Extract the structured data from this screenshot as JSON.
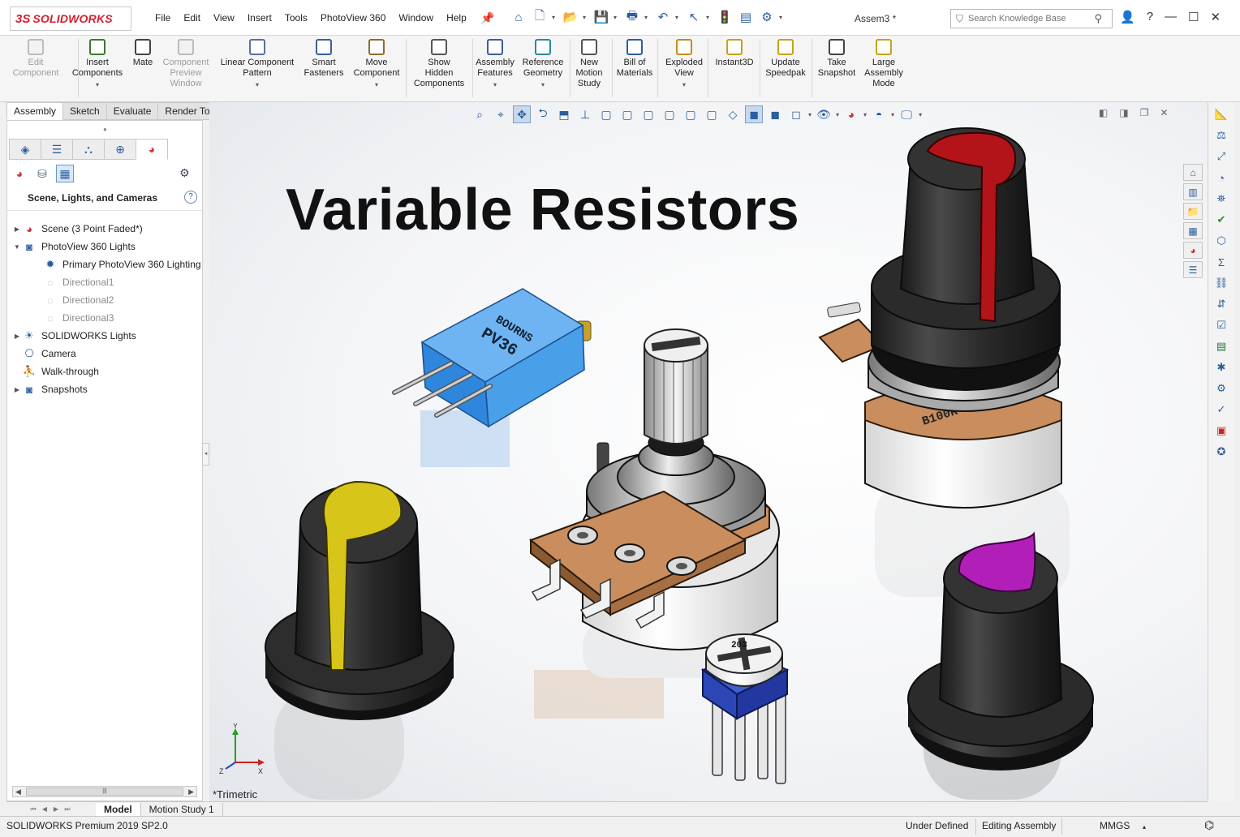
{
  "app": {
    "logo_mark": "3S",
    "logo_text": "SOLIDWORKS",
    "document_title": "Assem3 *",
    "menu": [
      "File",
      "Edit",
      "View",
      "Insert",
      "Tools",
      "PhotoView 360",
      "Window",
      "Help"
    ],
    "search_placeholder": "Search Knowledge Base",
    "window_controls": [
      "person-icon",
      "help-icon",
      "minimize-icon",
      "maximize-icon",
      "close-icon"
    ]
  },
  "command_manager": {
    "commands": [
      {
        "label1": "Edit",
        "label2": "Component",
        "label3": "",
        "enabled": false,
        "dropdown": false,
        "icon": "edit-component-icon"
      },
      {
        "label1": "Insert",
        "label2": "Components",
        "label3": "",
        "enabled": true,
        "dropdown": true,
        "icon": "insert-components-icon"
      },
      {
        "label1": "Mate",
        "label2": "",
        "label3": "",
        "enabled": true,
        "dropdown": false,
        "icon": "mate-icon"
      },
      {
        "label1": "Component",
        "label2": "Preview",
        "label3": "Window",
        "enabled": false,
        "dropdown": false,
        "icon": "component-preview-icon"
      },
      {
        "label1": "Linear Component",
        "label2": "Pattern",
        "label3": "",
        "enabled": true,
        "dropdown": true,
        "icon": "linear-pattern-icon"
      },
      {
        "label1": "Smart",
        "label2": "Fasteners",
        "label3": "",
        "enabled": true,
        "dropdown": false,
        "icon": "smart-fasteners-icon"
      },
      {
        "label1": "Move",
        "label2": "Component",
        "label3": "",
        "enabled": true,
        "dropdown": true,
        "icon": "move-component-icon"
      },
      {
        "label1": "Show",
        "label2": "Hidden",
        "label3": "Components",
        "enabled": true,
        "dropdown": false,
        "icon": "show-hidden-icon"
      },
      {
        "label1": "Assembly",
        "label2": "Features",
        "label3": "",
        "enabled": true,
        "dropdown": true,
        "icon": "assembly-features-icon"
      },
      {
        "label1": "Reference",
        "label2": "Geometry",
        "label3": "",
        "enabled": true,
        "dropdown": true,
        "icon": "reference-geometry-icon"
      },
      {
        "label1": "New",
        "label2": "Motion",
        "label3": "Study",
        "enabled": true,
        "dropdown": false,
        "icon": "motion-study-icon"
      },
      {
        "label1": "Bill of",
        "label2": "Materials",
        "label3": "",
        "enabled": true,
        "dropdown": false,
        "icon": "bom-icon"
      },
      {
        "label1": "Exploded",
        "label2": "View",
        "label3": "",
        "enabled": true,
        "dropdown": true,
        "icon": "exploded-view-icon"
      },
      {
        "label1": "Instant3D",
        "label2": "",
        "label3": "",
        "enabled": true,
        "dropdown": false,
        "icon": "instant3d-icon"
      },
      {
        "label1": "Update",
        "label2": "Speedpak",
        "label3": "",
        "enabled": true,
        "dropdown": false,
        "icon": "speedpak-icon"
      },
      {
        "label1": "Take",
        "label2": "Snapshot",
        "label3": "",
        "enabled": true,
        "dropdown": false,
        "icon": "snapshot-icon"
      },
      {
        "label1": "Large",
        "label2": "Assembly",
        "label3": "Mode",
        "enabled": true,
        "dropdown": false,
        "icon": "large-assembly-icon"
      }
    ],
    "tabs": [
      "Assembly",
      "Sketch",
      "Evaluate",
      "Render Tools"
    ],
    "active_tab": "Assembly"
  },
  "left_panel": {
    "title": "Scene, Lights, and Cameras",
    "help": "?",
    "tree": [
      {
        "label": "Scene (3 Point Faded*)",
        "level": 0,
        "expander": "▶",
        "dim": false,
        "icon": "scene-icon"
      },
      {
        "label": "PhotoView 360 Lights",
        "level": 0,
        "expander": "▼",
        "dim": false,
        "icon": "photoview-lights-icon"
      },
      {
        "label": "Primary PhotoView 360 Lighting",
        "level": 1,
        "expander": "",
        "dim": false,
        "icon": "primary-lighting-icon"
      },
      {
        "label": "Directional1",
        "level": 1,
        "expander": "",
        "dim": true,
        "icon": "directional-light-icon"
      },
      {
        "label": "Directional2",
        "level": 1,
        "expander": "",
        "dim": true,
        "icon": "directional-light-icon"
      },
      {
        "label": "Directional3",
        "level": 1,
        "expander": "",
        "dim": true,
        "icon": "directional-light-icon"
      },
      {
        "label": "SOLIDWORKS Lights",
        "level": 0,
        "expander": "▶",
        "dim": false,
        "icon": "solidworks-lights-icon"
      },
      {
        "label": "Camera",
        "level": 0,
        "expander": "",
        "dim": false,
        "icon": "camera-icon"
      },
      {
        "label": "Walk-through",
        "level": 0,
        "expander": "",
        "dim": false,
        "icon": "walkthrough-icon"
      },
      {
        "label": "Snapshots",
        "level": 0,
        "expander": "▶",
        "dim": false,
        "icon": "snapshots-icon"
      }
    ]
  },
  "viewport": {
    "title": "Variable Resistors",
    "view_name": "*Trimetric",
    "pv36_brand": "BOURNS",
    "pv36_model": "PV36",
    "trimmer_code": "203",
    "knob_pot_label": "B100K",
    "triad": {
      "y": "Y",
      "x": "X",
      "z": "Z"
    },
    "colors": {
      "knob_yellow": "#d8c51a",
      "knob_red": "#b3141a",
      "knob_magenta": "#b21fb8",
      "knob_body": "#2b2b2b",
      "pv36_blue": "#3f8fe0",
      "trimmer_blue": "#2c47b5",
      "pcb_copper": "#c98d5e"
    }
  },
  "bottom": {
    "tabs": [
      "Model",
      "Motion Study 1"
    ],
    "active_tab": "Model"
  },
  "status": {
    "product": "SOLIDWORKS Premium 2019 SP2.0",
    "state": "Under Defined",
    "mode": "Editing Assembly",
    "units": "MMGS"
  }
}
